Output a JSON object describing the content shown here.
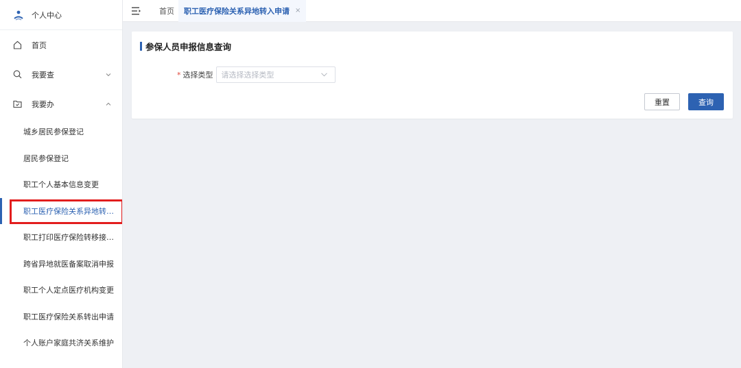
{
  "sidebar": {
    "header_title": "个人中心",
    "top_items": [
      {
        "label": "首页"
      },
      {
        "label": "我要查"
      },
      {
        "label": "我要办"
      }
    ],
    "sub_items": [
      {
        "label": "城乡居民参保登记"
      },
      {
        "label": "居民参保登记"
      },
      {
        "label": "职工个人基本信息变更"
      },
      {
        "label": "职工医疗保险关系异地转入申请"
      },
      {
        "label": "职工打印医疗保险转移接续申请"
      },
      {
        "label": "跨省异地就医备案取消申报"
      },
      {
        "label": "职工个人定点医疗机构变更"
      },
      {
        "label": "职工医疗保险关系转出申请"
      },
      {
        "label": "个人账户家庭共济关系维护"
      }
    ]
  },
  "tabs": {
    "home": "首页",
    "active": "职工医疗保险关系异地转入申请",
    "close": "×"
  },
  "card": {
    "title": "参保人员申报信息查询",
    "required_mark": "*",
    "select_label": "选择类型",
    "select_placeholder": "请选择选择类型",
    "reset_label": "重置",
    "query_label": "查询"
  },
  "colors": {
    "accent": "#2d62b2",
    "highlight_box": "#e21d1d"
  }
}
